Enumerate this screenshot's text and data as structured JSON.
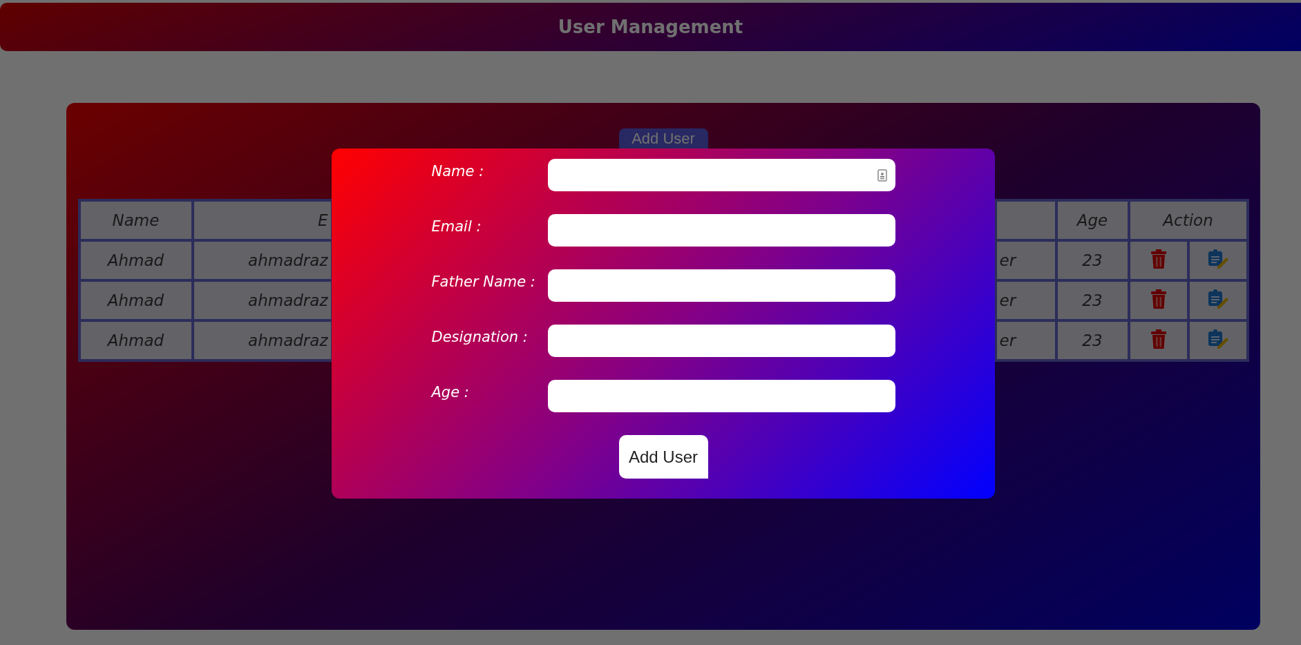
{
  "header": {
    "title": "User Management"
  },
  "add_button": {
    "label": "Add User"
  },
  "table": {
    "columns": [
      {
        "label": "Name"
      },
      {
        "label": "E"
      },
      {
        "label": "Age"
      },
      {
        "label": "Action"
      }
    ],
    "rows": [
      {
        "name": "Ahmad",
        "email": "ahmadraz",
        "designation": "er",
        "age": "23"
      },
      {
        "name": "Ahmad",
        "email": "ahmadraz",
        "designation": "er",
        "age": "23"
      },
      {
        "name": "Ahmad",
        "email": "ahmadraz",
        "designation": "er",
        "age": "23"
      }
    ]
  },
  "modal": {
    "fields": [
      {
        "label": "Name :",
        "autofill": true
      },
      {
        "label": "Email :",
        "autofill": false
      },
      {
        "label": "Father Name :",
        "autofill": false
      },
      {
        "label": "Designation :",
        "autofill": false
      },
      {
        "label": "Age :",
        "autofill": false
      }
    ],
    "submit": "Add User"
  }
}
